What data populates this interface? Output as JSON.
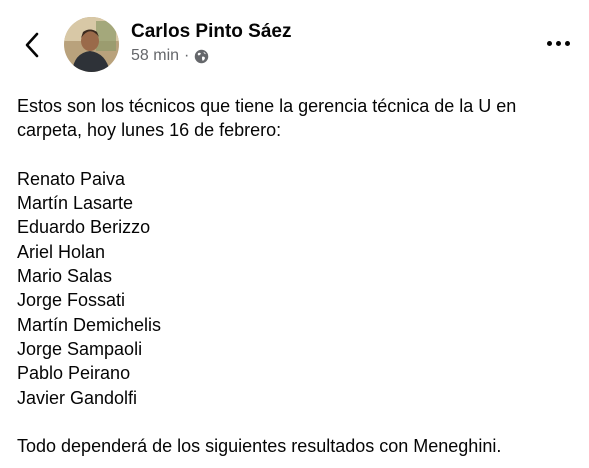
{
  "post": {
    "author": "Carlos Pinto Sáez",
    "time": "58 min",
    "separator": "·",
    "privacy_icon": "globe-icon",
    "intro": "Estos son los técnicos que tiene la gerencia técnica de la U en carpeta, hoy lunes 16 de febrero:",
    "coaches": [
      "Renato Paiva",
      "Martín Lasarte",
      "Eduardo Berizzo",
      "Ariel Holan",
      "Mario Salas",
      "Jorge Fossati",
      "Martín Demichelis",
      "Jorge Sampaoli",
      "Pablo Peirano",
      "Javier Gandolfi"
    ],
    "outro": "Todo dependerá de los siguientes resultados con Meneghini."
  },
  "icons": {
    "back": "chevron-left-icon",
    "more": "more-options-icon"
  },
  "colors": {
    "text": "#050505",
    "secondary": "#65676b"
  }
}
